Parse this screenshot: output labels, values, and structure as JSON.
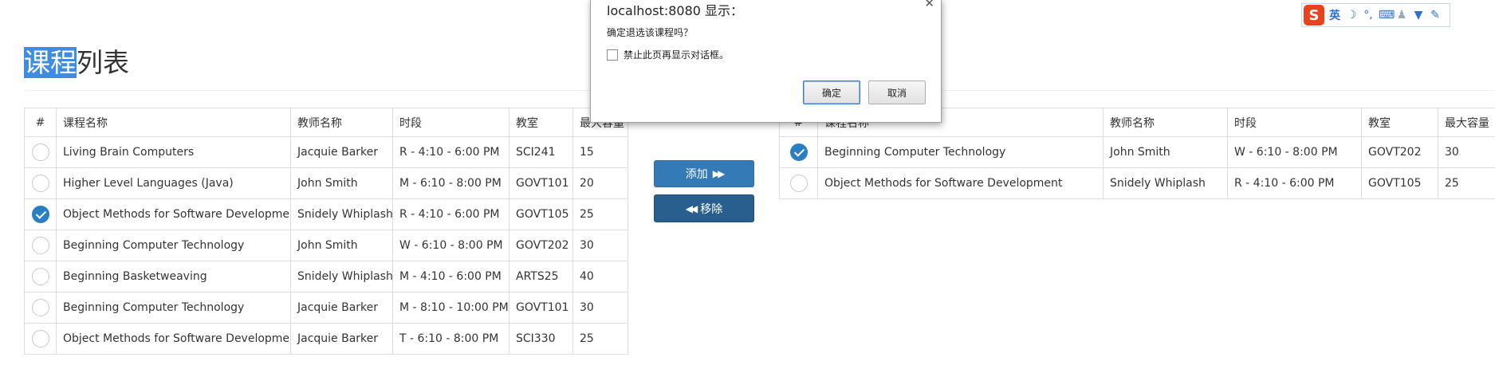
{
  "page": {
    "title_selected": "课程",
    "title_rest": "列表"
  },
  "left_table": {
    "headers": [
      "#",
      "课程名称",
      "教师名称",
      "时段",
      "教室",
      "最大容量"
    ],
    "rows": [
      {
        "checked": false,
        "course": "Living Brain Computers",
        "teacher": "Jacquie Barker",
        "time": "R - 4:10 - 6:00 PM",
        "room": "SCI241",
        "capacity": "15"
      },
      {
        "checked": false,
        "course": "Higher Level Languages (Java)",
        "teacher": "John Smith",
        "time": "M - 6:10 - 8:00 PM",
        "room": "GOVT101",
        "capacity": "20"
      },
      {
        "checked": true,
        "course": "Object Methods for Software Development",
        "teacher": "Snidely Whiplash",
        "time": "R - 4:10 - 6:00 PM",
        "room": "GOVT105",
        "capacity": "25"
      },
      {
        "checked": false,
        "course": "Beginning Computer Technology",
        "teacher": "John Smith",
        "time": "W - 6:10 - 8:00 PM",
        "room": "GOVT202",
        "capacity": "30"
      },
      {
        "checked": false,
        "course": "Beginning Basketweaving",
        "teacher": "Snidely Whiplash",
        "time": "M - 4:10 - 6:00 PM",
        "room": "ARTS25",
        "capacity": "40"
      },
      {
        "checked": false,
        "course": "Beginning Computer Technology",
        "teacher": "Jacquie Barker",
        "time": "M - 8:10 - 10:00 PM",
        "room": "GOVT101",
        "capacity": "30"
      },
      {
        "checked": false,
        "course": "Object Methods for Software Development",
        "teacher": "Jacquie Barker",
        "time": "T - 6:10 - 8:00 PM",
        "room": "SCI330",
        "capacity": "25"
      }
    ]
  },
  "right_table": {
    "headers": [
      "#",
      "课程名称",
      "教师名称",
      "时段",
      "教室",
      "最大容量"
    ],
    "rows": [
      {
        "checked": true,
        "course": "Beginning Computer Technology",
        "teacher": "John Smith",
        "time": "W - 6:10 - 8:00 PM",
        "room": "GOVT202",
        "capacity": "30"
      },
      {
        "checked": false,
        "course": "Object Methods for Software Development",
        "teacher": "Snidely Whiplash",
        "time": "R - 4:10 - 6:00 PM",
        "room": "GOVT105",
        "capacity": "25"
      }
    ]
  },
  "buttons": {
    "add_label": "添加",
    "add_icon": "double-right-arrow-icon",
    "remove_label": "移除",
    "remove_icon": "double-left-arrow-icon"
  },
  "dialog": {
    "title": "localhost:8080 显示：",
    "message": "确定退选该课程吗？",
    "checkbox_label": "禁止此页再显示对话框。",
    "checkbox_checked": false,
    "ok_label": "确定",
    "cancel_label": "取消",
    "close_icon": "close-icon"
  },
  "ime_toolbar": {
    "logo_icon": "sogou-logo-icon",
    "logo_text": "S",
    "language": "英",
    "items": [
      "moon-icon",
      "punctuation-icon",
      "keyboard-icon",
      "user-icon",
      "skin-icon",
      "wrench-icon"
    ]
  },
  "colors": {
    "primary": "#337ab7",
    "primary_dark": "#285f8f",
    "check": "#2a7fc4",
    "selection": "#3f8de0",
    "ime_logo": "#e8431c"
  }
}
